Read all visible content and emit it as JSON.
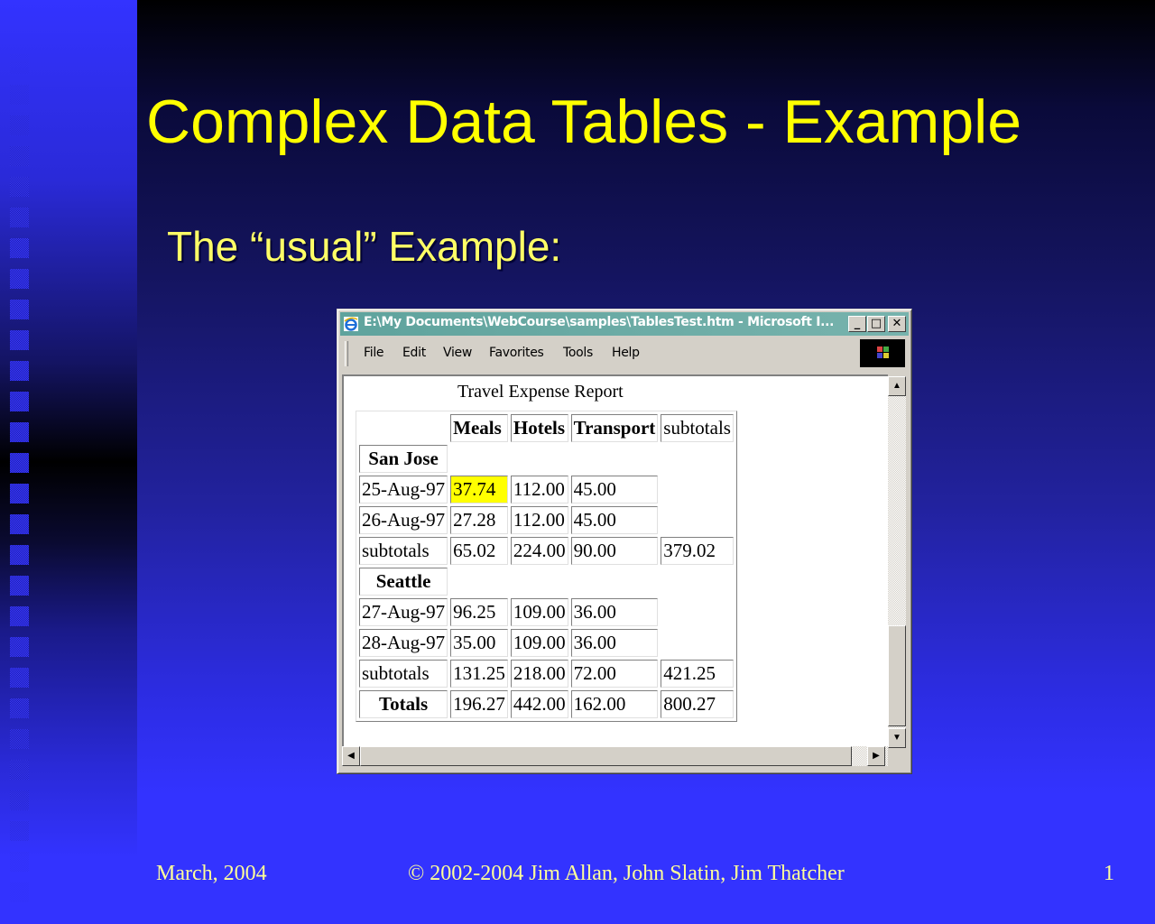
{
  "slide": {
    "title": "Complex Data Tables - Example",
    "subtitle": "The “usual” Example:",
    "colors": {
      "title": "#ffff00",
      "background": "#3333ff",
      "highlight_cell": "#ffff00"
    }
  },
  "footer": {
    "date": "March, 2004",
    "copyright": "© 2002-2004 Jim Allan, John Slatin, Jim Thatcher",
    "page_number": "1"
  },
  "browser": {
    "icon": "ie-icon",
    "window_title": "E:\\My Documents\\WebCourse\\samples\\TablesTest.htm - Microsoft I...",
    "controls": {
      "minimize": "_",
      "maximize": "□",
      "close": "✕"
    },
    "menu": [
      "File",
      "Edit",
      "View",
      "Favorites",
      "Tools",
      "Help"
    ],
    "scroll": {
      "up": "▲",
      "down": "▼",
      "left": "◀",
      "right": "▶"
    }
  },
  "table": {
    "caption": "Travel Expense Report",
    "headers": [
      "",
      "Meals",
      "Hotels",
      "Transport",
      "subtotals"
    ],
    "groups": [
      {
        "city": "San Jose",
        "rows": [
          {
            "date": "25-Aug-97",
            "meals": "37.74",
            "hotels": "112.00",
            "transport": "45.00"
          },
          {
            "date": "26-Aug-97",
            "meals": "27.28",
            "hotels": "112.00",
            "transport": "45.00"
          }
        ],
        "subtotal": {
          "label": "subtotals",
          "meals": "65.02",
          "hotels": "224.00",
          "transport": "90.00",
          "total": "379.02"
        }
      },
      {
        "city": "Seattle",
        "rows": [
          {
            "date": "27-Aug-97",
            "meals": "96.25",
            "hotels": "109.00",
            "transport": "36.00"
          },
          {
            "date": "28-Aug-97",
            "meals": "35.00",
            "hotels": "109.00",
            "transport": "36.00"
          }
        ],
        "subtotal": {
          "label": "subtotals",
          "meals": "131.25",
          "hotels": "218.00",
          "transport": "72.00",
          "total": "421.25"
        }
      }
    ],
    "totals": {
      "label": "Totals",
      "meals": "196.27",
      "hotels": "442.00",
      "transport": "162.00",
      "total": "800.27"
    }
  }
}
